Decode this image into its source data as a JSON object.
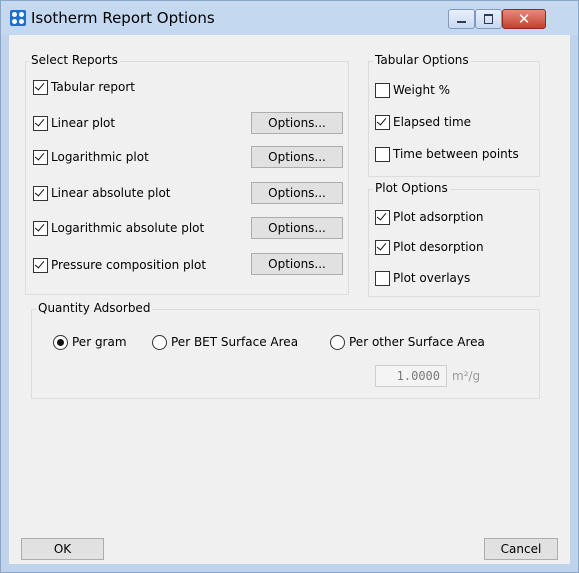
{
  "window": {
    "title": "Isotherm Report Options"
  },
  "select_reports": {
    "title": "Select Reports",
    "items": [
      {
        "label": "Tabular report",
        "checked": true
      },
      {
        "label": "Linear plot",
        "checked": true,
        "button": "Options..."
      },
      {
        "label": "Logarithmic plot",
        "checked": true,
        "button": "Options..."
      },
      {
        "label": "Linear absolute plot",
        "checked": true,
        "button": "Options..."
      },
      {
        "label": "Logarithmic absolute plot",
        "checked": true,
        "button": "Options..."
      },
      {
        "label": "Pressure composition plot",
        "checked": true,
        "button": "Options..."
      }
    ]
  },
  "tabular_options": {
    "title": "Tabular Options",
    "items": [
      {
        "label": "Weight %",
        "checked": false
      },
      {
        "label": "Elapsed time",
        "checked": true
      },
      {
        "label": "Time between points",
        "checked": false
      }
    ]
  },
  "plot_options": {
    "title": "Plot Options",
    "items": [
      {
        "label": "Plot adsorption",
        "checked": true
      },
      {
        "label": "Plot desorption",
        "checked": true
      },
      {
        "label": "Plot overlays",
        "checked": false
      }
    ]
  },
  "quantity_adsorbed": {
    "title": "Quantity Adsorbed",
    "options": [
      {
        "label": "Per gram",
        "selected": true
      },
      {
        "label": "Per BET Surface Area",
        "selected": false
      },
      {
        "label": "Per other Surface Area",
        "selected": false
      }
    ],
    "area_value": "1.0000",
    "area_unit": "m²/g"
  },
  "buttons": {
    "ok": "OK",
    "cancel": "Cancel"
  }
}
